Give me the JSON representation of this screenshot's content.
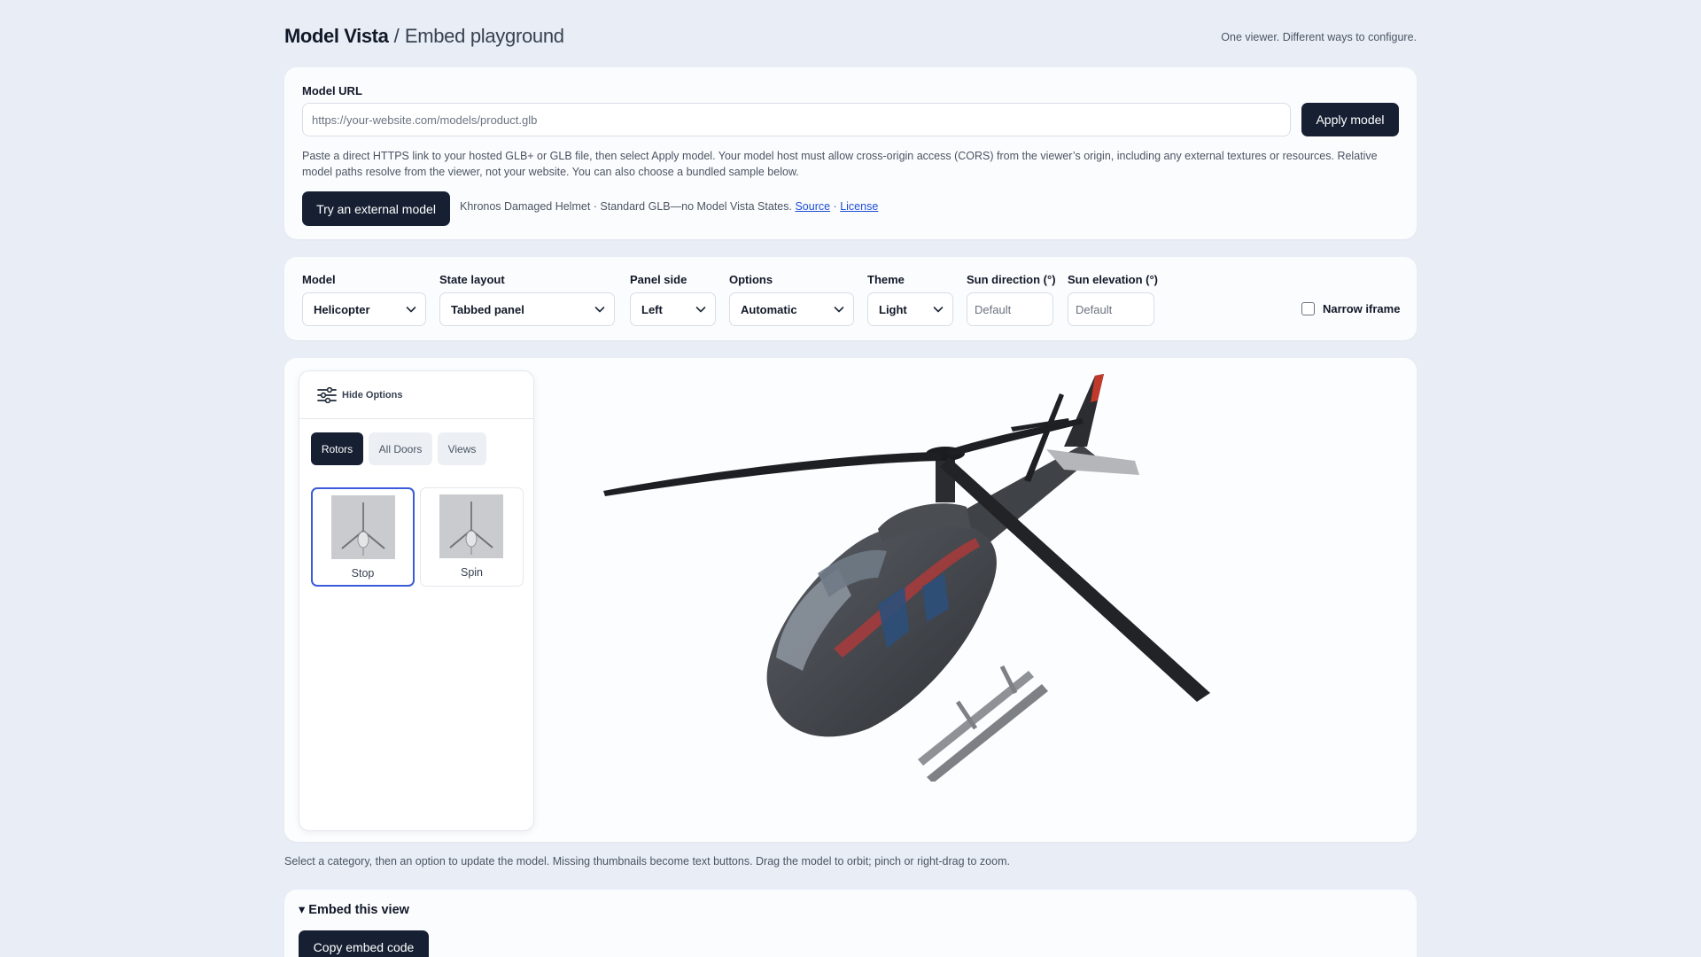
{
  "header": {
    "brand": "Model Vista",
    "separator": "/",
    "subtitle": "Embed playground",
    "tagline": "One viewer. Different ways to configure."
  },
  "model_url": {
    "label": "Model URL",
    "placeholder": "https://your-website.com/models/product.glb",
    "apply_button": "Apply model",
    "help_text": "Paste a direct HTTPS link to your hosted GLB+ or GLB file, then select Apply model. Your model host must allow cross-origin access (CORS) from the viewer’s origin, including any external textures or resources. Relative model paths resolve from the viewer, not your website. You can also choose a bundled sample below.",
    "external_button": "Try an external model",
    "external_note": "Khronos Damaged Helmet · Standard GLB—no Model Vista States.",
    "source_link": "Source",
    "dot": "·",
    "license_link": "License"
  },
  "controls": {
    "model": {
      "label": "Model",
      "value": "Helicopter"
    },
    "state_layout": {
      "label": "State layout",
      "value": "Tabbed panel"
    },
    "panel_side": {
      "label": "Panel side",
      "value": "Left"
    },
    "options": {
      "label": "Options",
      "value": "Automatic"
    },
    "theme": {
      "label": "Theme",
      "value": "Light"
    },
    "sun_direction": {
      "label": "Sun direction (°)",
      "placeholder": "Default"
    },
    "sun_elevation": {
      "label": "Sun elevation (°)",
      "placeholder": "Default"
    },
    "narrow_iframe": {
      "label": "Narrow iframe",
      "checked": false
    }
  },
  "viewer": {
    "hide_options": "Hide Options",
    "tabs": [
      {
        "label": "Rotors",
        "active": true
      },
      {
        "label": "All Doors",
        "active": false
      },
      {
        "label": "Views",
        "active": false
      }
    ],
    "states": [
      {
        "label": "Stop",
        "selected": true
      },
      {
        "label": "Spin",
        "selected": false
      }
    ]
  },
  "caption": "Select a category, then an option to update the model. Missing thumbnails become text buttons. Drag the model to orbit; pinch or right-drag to zoom.",
  "embed": {
    "title": "▾ Embed this view",
    "copy_button": "Copy embed code"
  },
  "colors": {
    "background": "#e9eef6",
    "primary_dark": "#172033",
    "selected_outline": "#3b5bdb",
    "link": "#1d4ed8"
  }
}
